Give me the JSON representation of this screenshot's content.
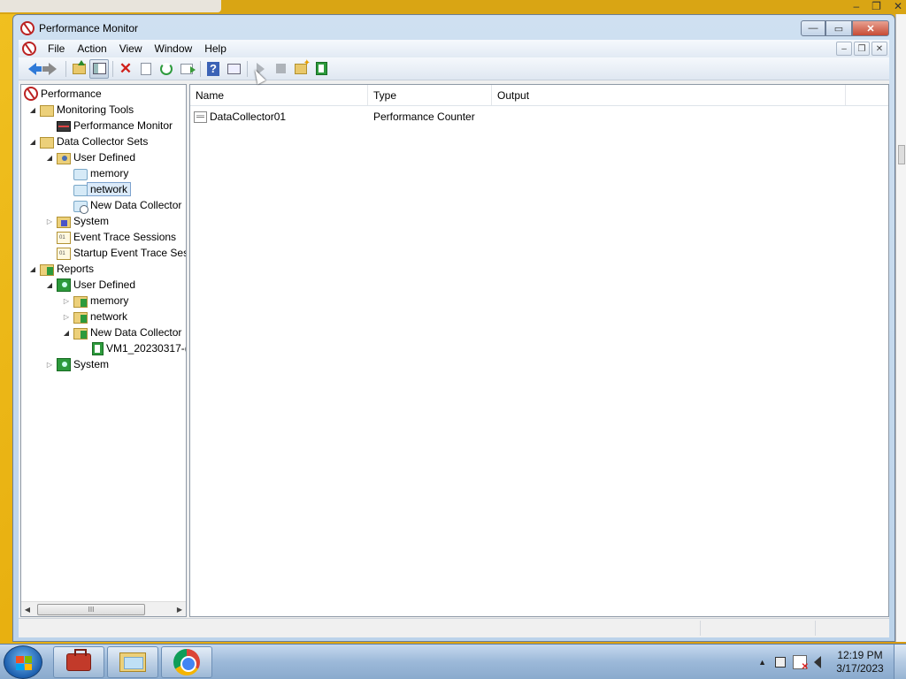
{
  "window": {
    "title": "Performance Monitor",
    "controls": {
      "minimize": "—",
      "maximize": "▭",
      "close": "✕"
    }
  },
  "menubar": {
    "items": [
      "File",
      "Action",
      "View",
      "Window",
      "Help"
    ],
    "child_controls": {
      "minimize": "–",
      "restore": "❐",
      "close": "✕"
    }
  },
  "toolbar": {
    "buttons": [
      "back-icon",
      "forward-icon",
      "up-one-level-icon",
      "show-hide-tree-icon",
      "delete-icon",
      "properties-icon",
      "refresh-icon",
      "export-list-icon",
      "help-icon",
      "show-hide-action-pane-icon",
      "start-icon",
      "stop-icon",
      "new-data-collector-set-icon",
      "latest-report-icon"
    ]
  },
  "tree": {
    "items": [
      {
        "label": "Performance",
        "icon": "performance-icon",
        "expander": ""
      },
      {
        "label": "Monitoring Tools",
        "icon": "folder-icon",
        "expander": "open"
      },
      {
        "label": "Performance Monitor",
        "icon": "monitor-icon",
        "expander": ""
      },
      {
        "label": "Data Collector Sets",
        "icon": "folder-icon",
        "expander": "open"
      },
      {
        "label": "User Defined",
        "icon": "user-folder-icon",
        "expander": "open"
      },
      {
        "label": "memory",
        "icon": "data-collector-set-icon",
        "expander": ""
      },
      {
        "label": "network",
        "icon": "data-collector-set-icon",
        "expander": "",
        "selected": true
      },
      {
        "label": "New Data Collector",
        "icon": "data-collector-set-running-icon",
        "expander": ""
      },
      {
        "label": "System",
        "icon": "system-folder-icon",
        "expander": "closed"
      },
      {
        "label": "Event Trace Sessions",
        "icon": "trace-icon",
        "expander": ""
      },
      {
        "label": "Startup Event Trace Ses",
        "icon": "trace-icon",
        "expander": ""
      },
      {
        "label": "Reports",
        "icon": "report-folder-icon",
        "expander": "open"
      },
      {
        "label": "User Defined",
        "icon": "report-user-icon",
        "expander": "open"
      },
      {
        "label": "memory",
        "icon": "report-folder-icon",
        "expander": "closed"
      },
      {
        "label": "network",
        "icon": "report-folder-icon",
        "expander": "closed"
      },
      {
        "label": "New Data Collector",
        "icon": "report-folder-icon",
        "expander": "open"
      },
      {
        "label": "VM1_20230317-(",
        "icon": "report-icon",
        "expander": ""
      },
      {
        "label": "System",
        "icon": "report-user-icon",
        "expander": "closed"
      }
    ],
    "scroll_thumb_grip": "III"
  },
  "list": {
    "columns": [
      "Name",
      "Type",
      "Output"
    ],
    "rows": [
      {
        "name": "DataCollector01",
        "type": "Performance Counter",
        "output": ""
      }
    ]
  },
  "taskbar": {
    "apps": [
      "toolbox-icon",
      "windows-explorer-icon",
      "chrome-icon"
    ],
    "tray_arrow": "▲",
    "clock": {
      "time": "12:19 PM",
      "date": "3/17/2023"
    }
  }
}
